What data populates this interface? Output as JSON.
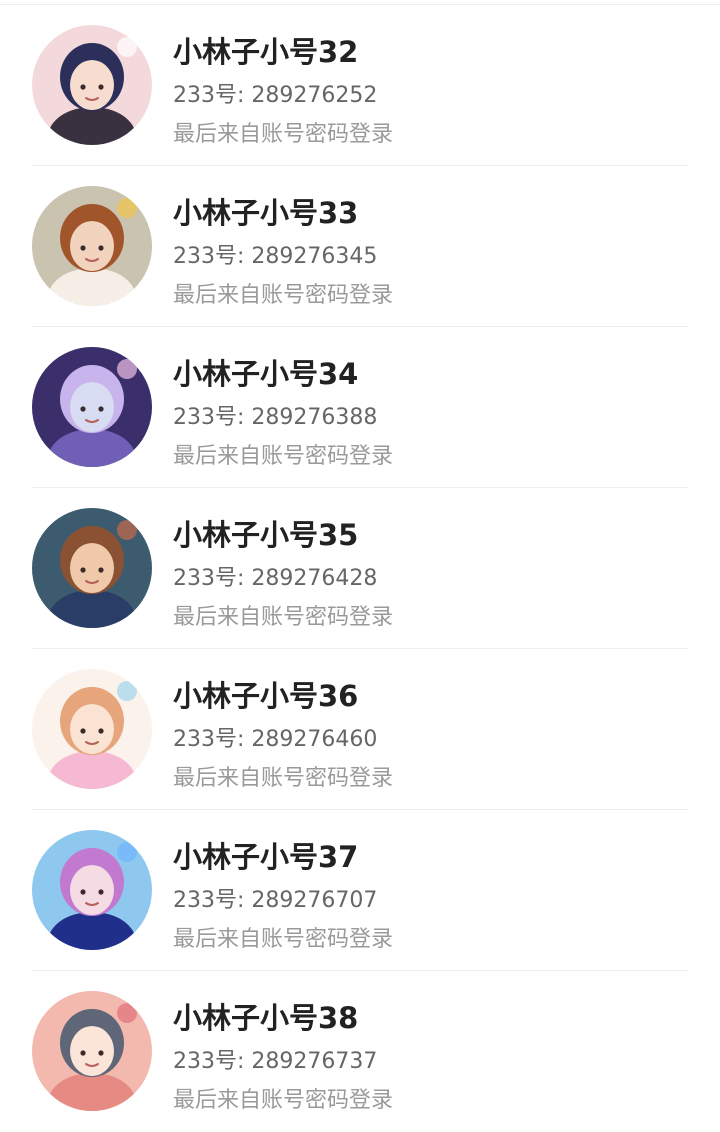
{
  "accounts": [
    {
      "name": "小林子小号32",
      "uid_text": "233号: 289276252",
      "last_login": "最后来自账号密码登录",
      "avatar": {
        "bg": "#f4d9dc",
        "hair": "#2b2f5a",
        "skin": "#f6ddd0",
        "body": "#3a3140",
        "accent": "#ffffff"
      }
    },
    {
      "name": "小林子小号33",
      "uid_text": "233号: 289276345",
      "last_login": "最后来自账号密码登录",
      "avatar": {
        "bg": "#c9c3b0",
        "hair": "#a0552b",
        "skin": "#f2d3bd",
        "body": "#f5efe8",
        "accent": "#f0c74a"
      }
    },
    {
      "name": "小林子小号34",
      "uid_text": "233号: 289276388",
      "last_login": "最后来自账号密码登录",
      "avatar": {
        "bg": "#3a2f6b",
        "hair": "#c8b4ec",
        "skin": "#d8dcf2",
        "body": "#6f5fb5",
        "accent": "#f2c1e6"
      }
    },
    {
      "name": "小林子小号35",
      "uid_text": "233号: 289276428",
      "last_login": "最后来自账号密码登录",
      "avatar": {
        "bg": "#3d5b6e",
        "hair": "#8a5232",
        "skin": "#f0c9ab",
        "body": "#2a3d66",
        "accent": "#c46a4a"
      }
    },
    {
      "name": "小林子小号36",
      "uid_text": "233号: 289276460",
      "last_login": "最后来自账号密码登录",
      "avatar": {
        "bg": "#fbf2ec",
        "hair": "#e6a57a",
        "skin": "#fbe3d3",
        "body": "#f6b9d4",
        "accent": "#9fd6ee"
      }
    },
    {
      "name": "小林子小号37",
      "uid_text": "233号: 289276707",
      "last_login": "最后来自账号密码登录",
      "avatar": {
        "bg": "#8ec8ef",
        "hair": "#c27ad0",
        "skin": "#f5dbe3",
        "body": "#1f2f8a",
        "accent": "#6fb3ff"
      }
    },
    {
      "name": "小林子小号38",
      "uid_text": "233号: 289276737",
      "last_login": "最后来自账号密码登录",
      "avatar": {
        "bg": "#f3b8ae",
        "hair": "#5e6677",
        "skin": "#fbe4d8",
        "body": "#e58b83",
        "accent": "#e0707a"
      }
    }
  ]
}
